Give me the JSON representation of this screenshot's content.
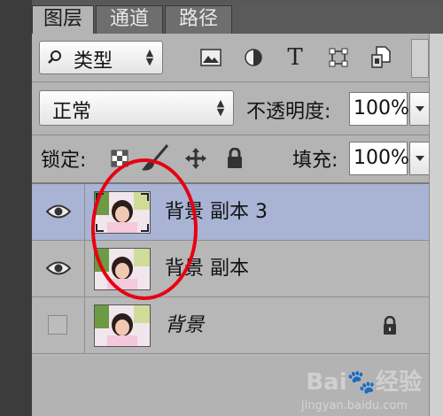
{
  "tabs": [
    {
      "label": "图层",
      "active": true
    },
    {
      "label": "通道",
      "active": false
    },
    {
      "label": "路径",
      "active": false
    }
  ],
  "filter": {
    "prefix_icon": "search-icon",
    "value": "类型"
  },
  "filter_icons": [
    "image-filter-icon",
    "adjustment-filter-icon",
    "type-filter-icon",
    "shape-filter-icon",
    "smart-object-filter-icon"
  ],
  "filter_icon_glyphs": {
    "type": "T"
  },
  "blend": {
    "mode": "正常",
    "opacity_label": "不透明度:",
    "opacity_value": "100%"
  },
  "lock": {
    "label": "锁定:",
    "icons": [
      "lock-transparent-icon",
      "lock-image-icon",
      "lock-position-icon",
      "lock-all-icon"
    ],
    "fill_label": "填充:",
    "fill_value": "100%"
  },
  "layers": [
    {
      "name": "背景 副本 3",
      "visible": true,
      "selected": true,
      "italic": false,
      "locked": false
    },
    {
      "name": "背景 副本",
      "visible": true,
      "selected": false,
      "italic": false,
      "locked": false
    },
    {
      "name": "背景",
      "visible": false,
      "selected": false,
      "italic": true,
      "locked": true
    }
  ],
  "annotation": {
    "color": "#e60012"
  },
  "watermark": {
    "brand": "Bai",
    "brand2": "经验",
    "url": "jingyan.baidu.com"
  }
}
